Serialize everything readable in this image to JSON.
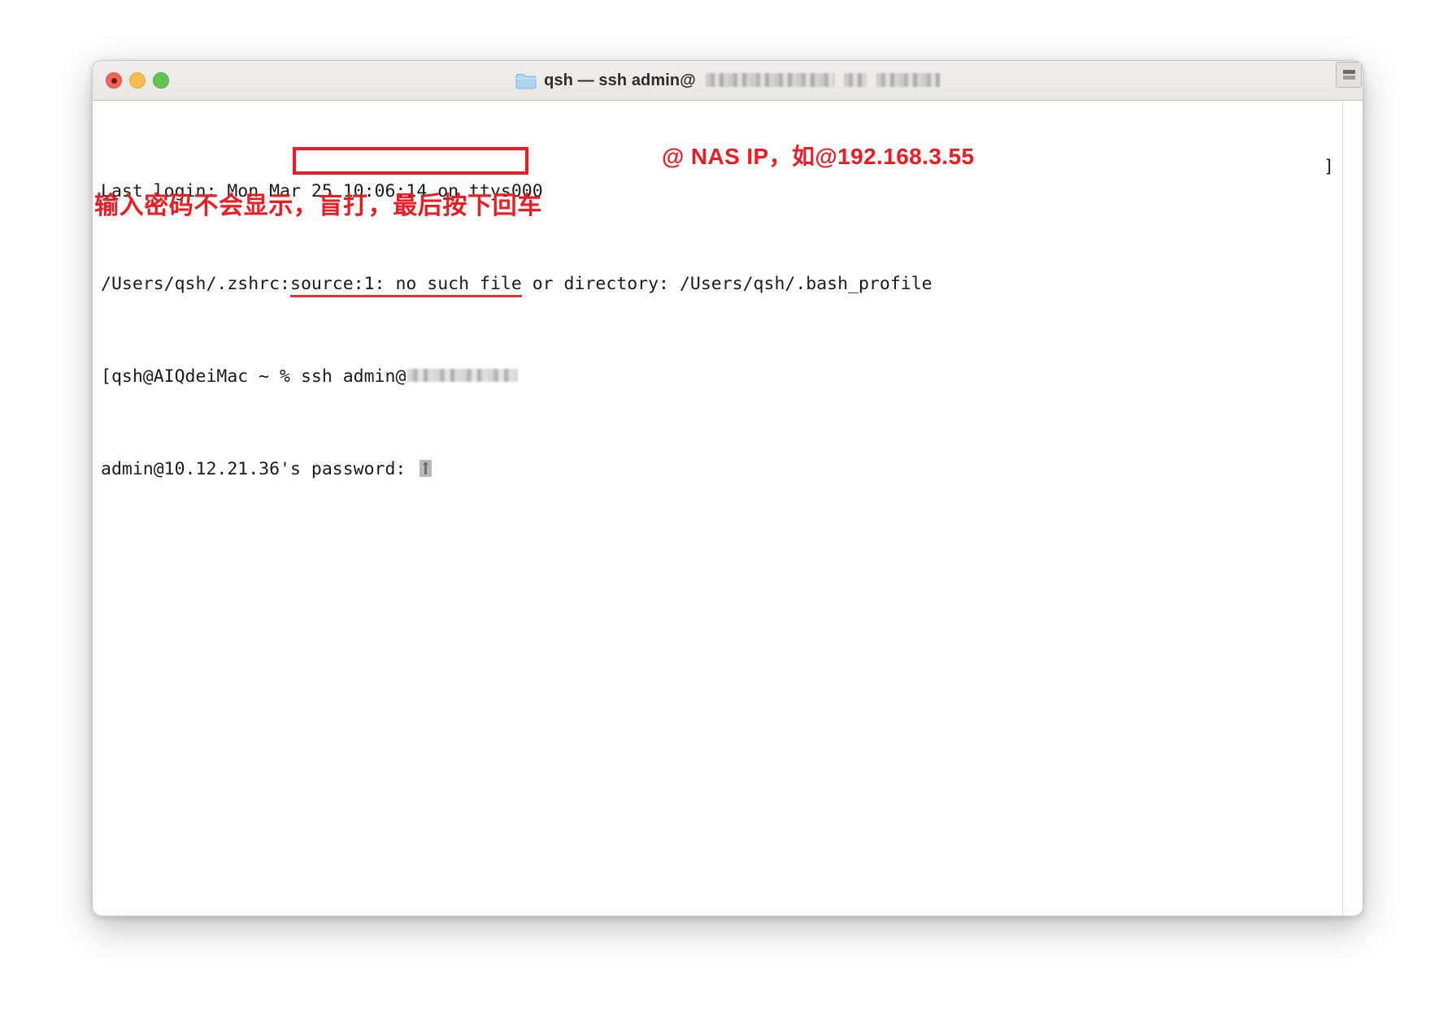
{
  "window": {
    "title_prefix": "qsh — ssh admin@",
    "title_redacted": true,
    "folder_icon": "folder-icon",
    "traffic_lights": {
      "close_label": "close",
      "minimize_label": "minimize",
      "maximize_label": "maximize"
    },
    "pane_split_icon": "split-pane-icon"
  },
  "terminal": {
    "lines": [
      {
        "id": "login",
        "text": "Last login: Mon Mar 25 10:06:14 on ttys000"
      },
      {
        "id": "zshrc_pre",
        "text": "/Users/qsh/.zshrc:"
      },
      {
        "id": "zshrc_underlined",
        "text": "source:1: no such file"
      },
      {
        "id": "zshrc_post",
        "text": " or directory: /Users/qsh/.bash_profile"
      },
      {
        "id": "prompt_open",
        "text": "[qsh@AIQdeiMac ~ % "
      },
      {
        "id": "ssh_cmd",
        "text": "ssh admin@"
      },
      {
        "id": "password_prompt",
        "text": "admin@10.12.21.36's password: "
      },
      {
        "id": "right_bracket",
        "text": "]"
      }
    ],
    "cursor_icon": "password-cursor-icon"
  },
  "annotations": {
    "ip_note": "@ NAS IP，如@192.168.3.55",
    "password_note": "输入密码不会显示，盲打，最后按下回车",
    "highlight_box_label": "ssh-command-highlight"
  },
  "colors": {
    "annotation_red": "#ee1b23",
    "underline_red": "#e8332c",
    "titlebar_bg": "#efeeec",
    "terminal_bg": "#ffffff",
    "terminal_fg": "#1a1a1a",
    "close_light": "#f2645c",
    "minimize_light": "#f5bd4f",
    "maximize_light": "#61c454"
  }
}
